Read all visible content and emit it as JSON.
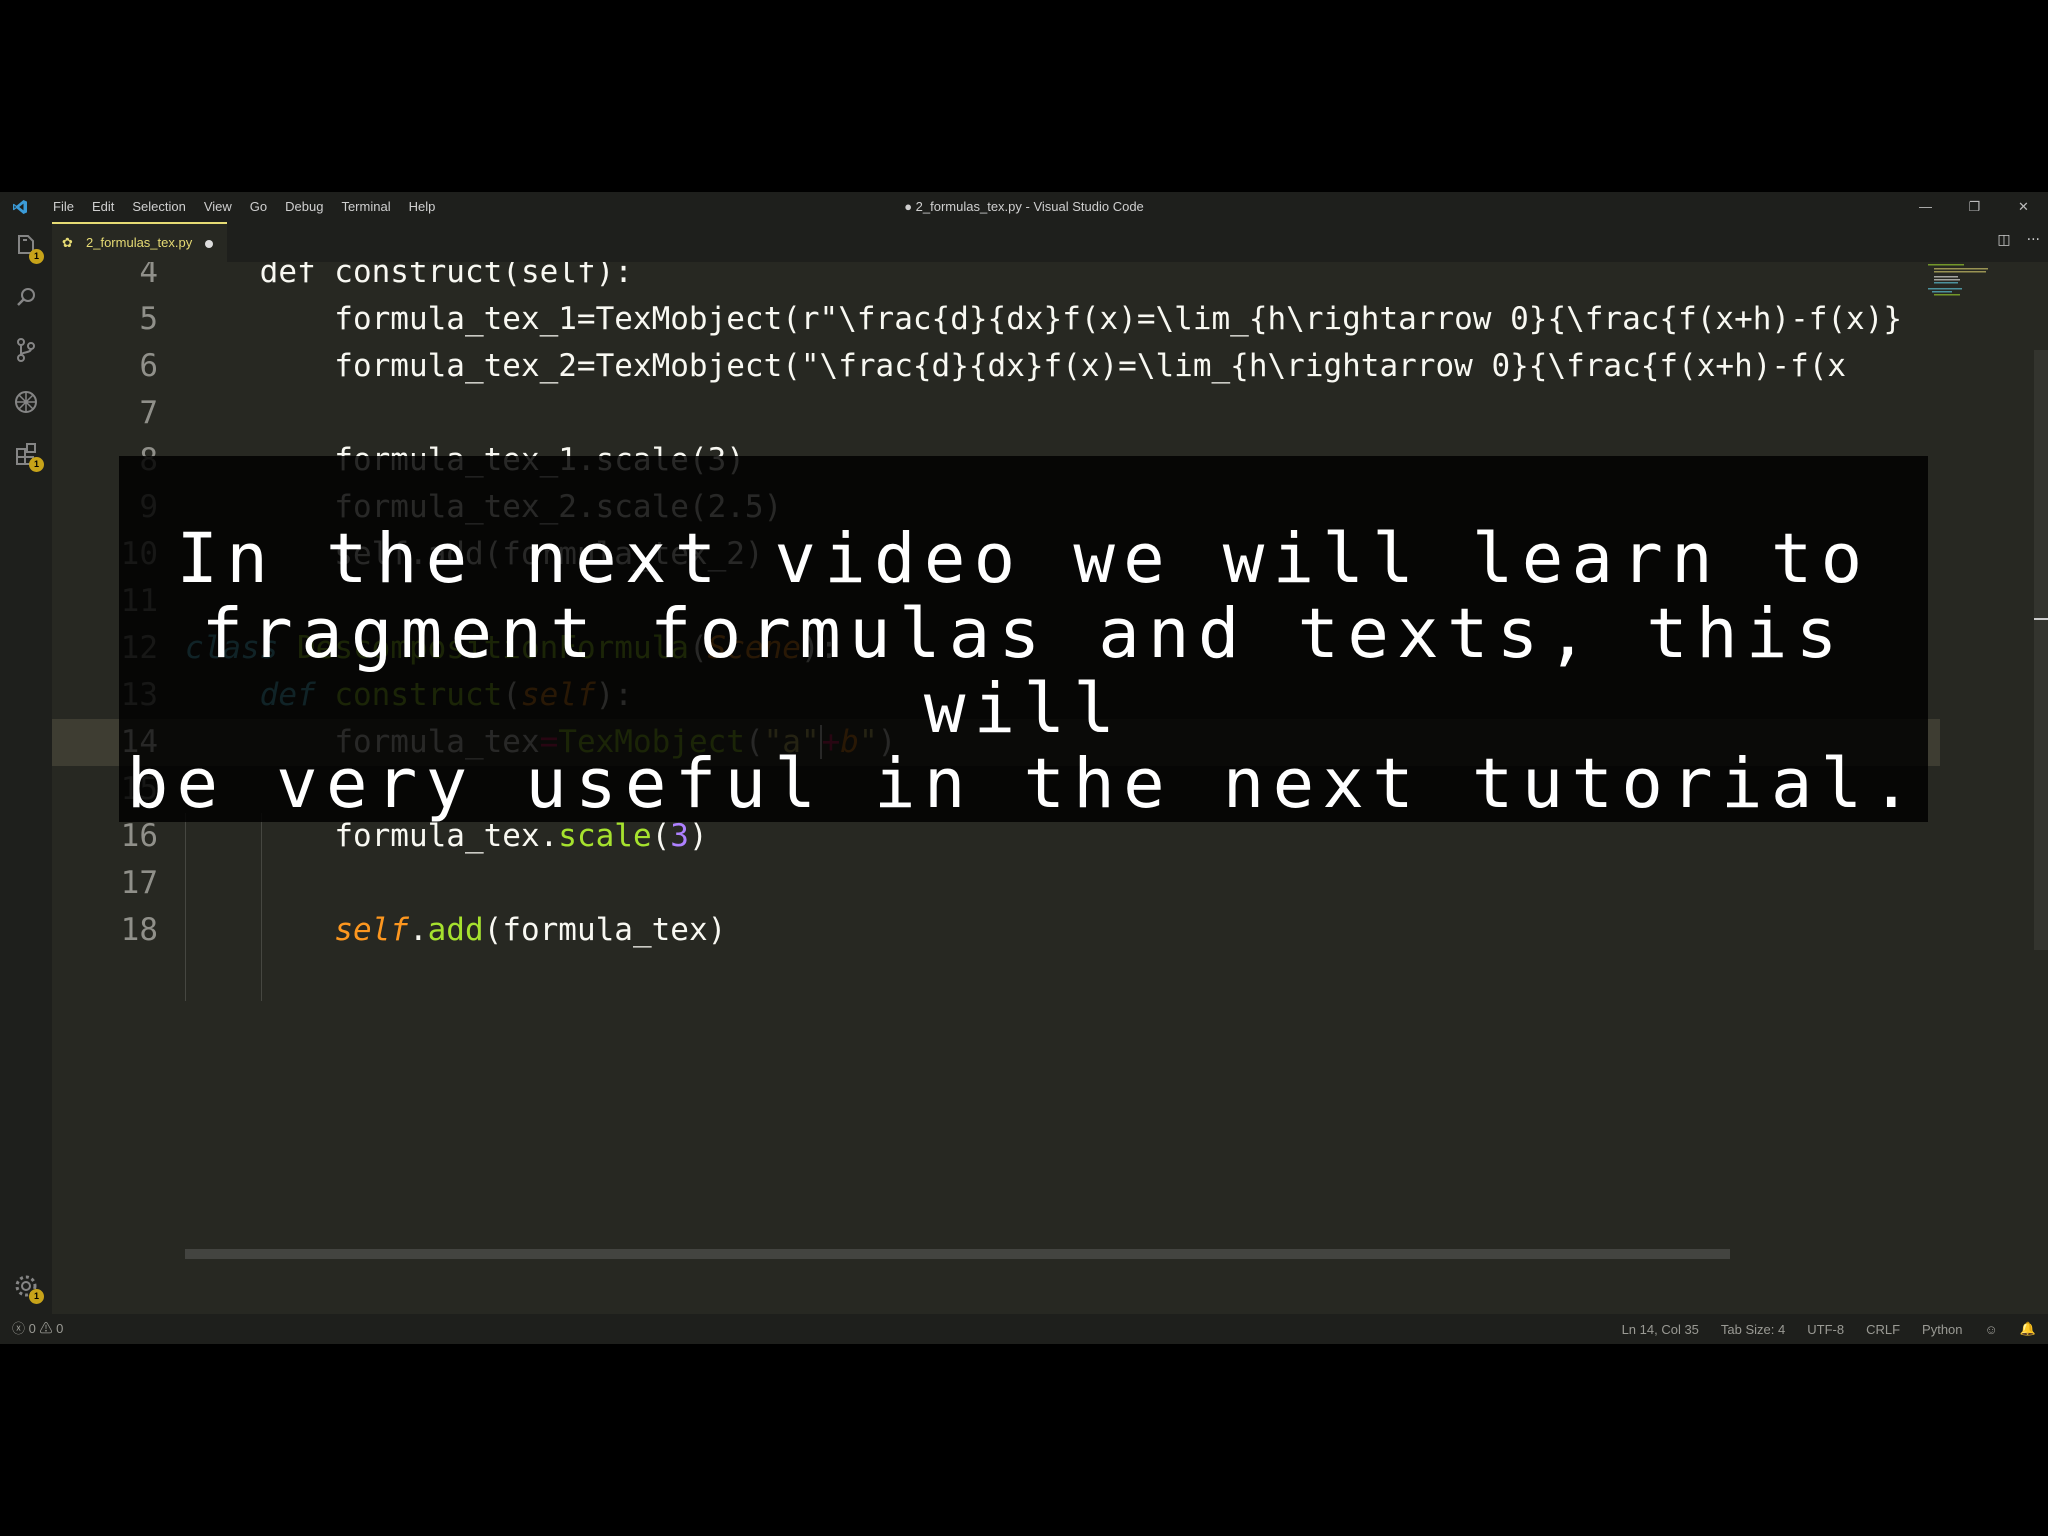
{
  "app": {
    "title": "● 2_formulas_tex.py - Visual Studio Code",
    "menu": [
      "File",
      "Edit",
      "Selection",
      "View",
      "Go",
      "Debug",
      "Terminal",
      "Help"
    ],
    "window_controls": [
      "—",
      "❐",
      "✕"
    ]
  },
  "activity_bar": {
    "explorer_badge": "1",
    "extensions_badge": "1",
    "settings_badge": "1"
  },
  "tab": {
    "label": "2_formulas_tex.py",
    "modified": true
  },
  "editor": {
    "lines": [
      {
        "num": "4",
        "code": "    def construct(self):"
      },
      {
        "num": "5",
        "code": "        formula_tex_1=TexMobject(r\"\\frac{d}{dx}f(x)=\\lim_{h\\rightarrow 0}{\\frac{f(x+h)-f(x)}"
      },
      {
        "num": "6",
        "code": "        formula_tex_2=TexMobject(\"\\frac{d}{dx}f(x)=\\lim_{h\\rightarrow 0}{\\frac{f(x+h)-f(x"
      },
      {
        "num": "7",
        "code": ""
      },
      {
        "num": "8",
        "code": "        formula_tex_1.scale(3)"
      },
      {
        "num": "9",
        "code": "        formula_tex_2.scale(2.5)"
      },
      {
        "num": "10",
        "code": "        self.add(formula_tex_2)"
      },
      {
        "num": "11",
        "code": ""
      },
      {
        "num": "12",
        "tokens": [
          "class",
          " ",
          "DescompositionFormula",
          "(",
          "Scene",
          "):"
        ]
      },
      {
        "num": "13",
        "tokens": [
          "    ",
          "def",
          " ",
          "construct",
          "(",
          "self",
          "):"
        ]
      },
      {
        "num": "14",
        "tokens": [
          "        ",
          "formula_tex",
          "=",
          "TexMobject",
          "(",
          "\"a\"",
          "+",
          "b",
          "\"",
          ")"
        ]
      },
      {
        "num": "15",
        "code": ""
      },
      {
        "num": "16",
        "tokens": [
          "        ",
          "formula_tex",
          ".",
          "scale",
          "(",
          "3",
          ")"
        ]
      },
      {
        "num": "17",
        "code": ""
      },
      {
        "num": "18",
        "tokens": [
          "        ",
          "self",
          ".",
          "add",
          "(",
          "formula_tex",
          ")"
        ]
      }
    ]
  },
  "caption": {
    "text": "In the next video we will learn to\nfragment formulas and texts, this will\nbe very useful in the next tutorial."
  },
  "status_bar": {
    "errors": "0",
    "warnings": "0",
    "position": "Ln 14, Col 35",
    "tab_size": "Tab Size: 4",
    "encoding": "UTF-8",
    "eol": "CRLF",
    "language": "Python"
  },
  "colors": {
    "background": "#272822",
    "keyword": "#66d9ef",
    "function": "#a6e22e",
    "string": "#e6db74",
    "operator": "#f92672",
    "number": "#ae81ff",
    "parameter": "#fd971f"
  }
}
